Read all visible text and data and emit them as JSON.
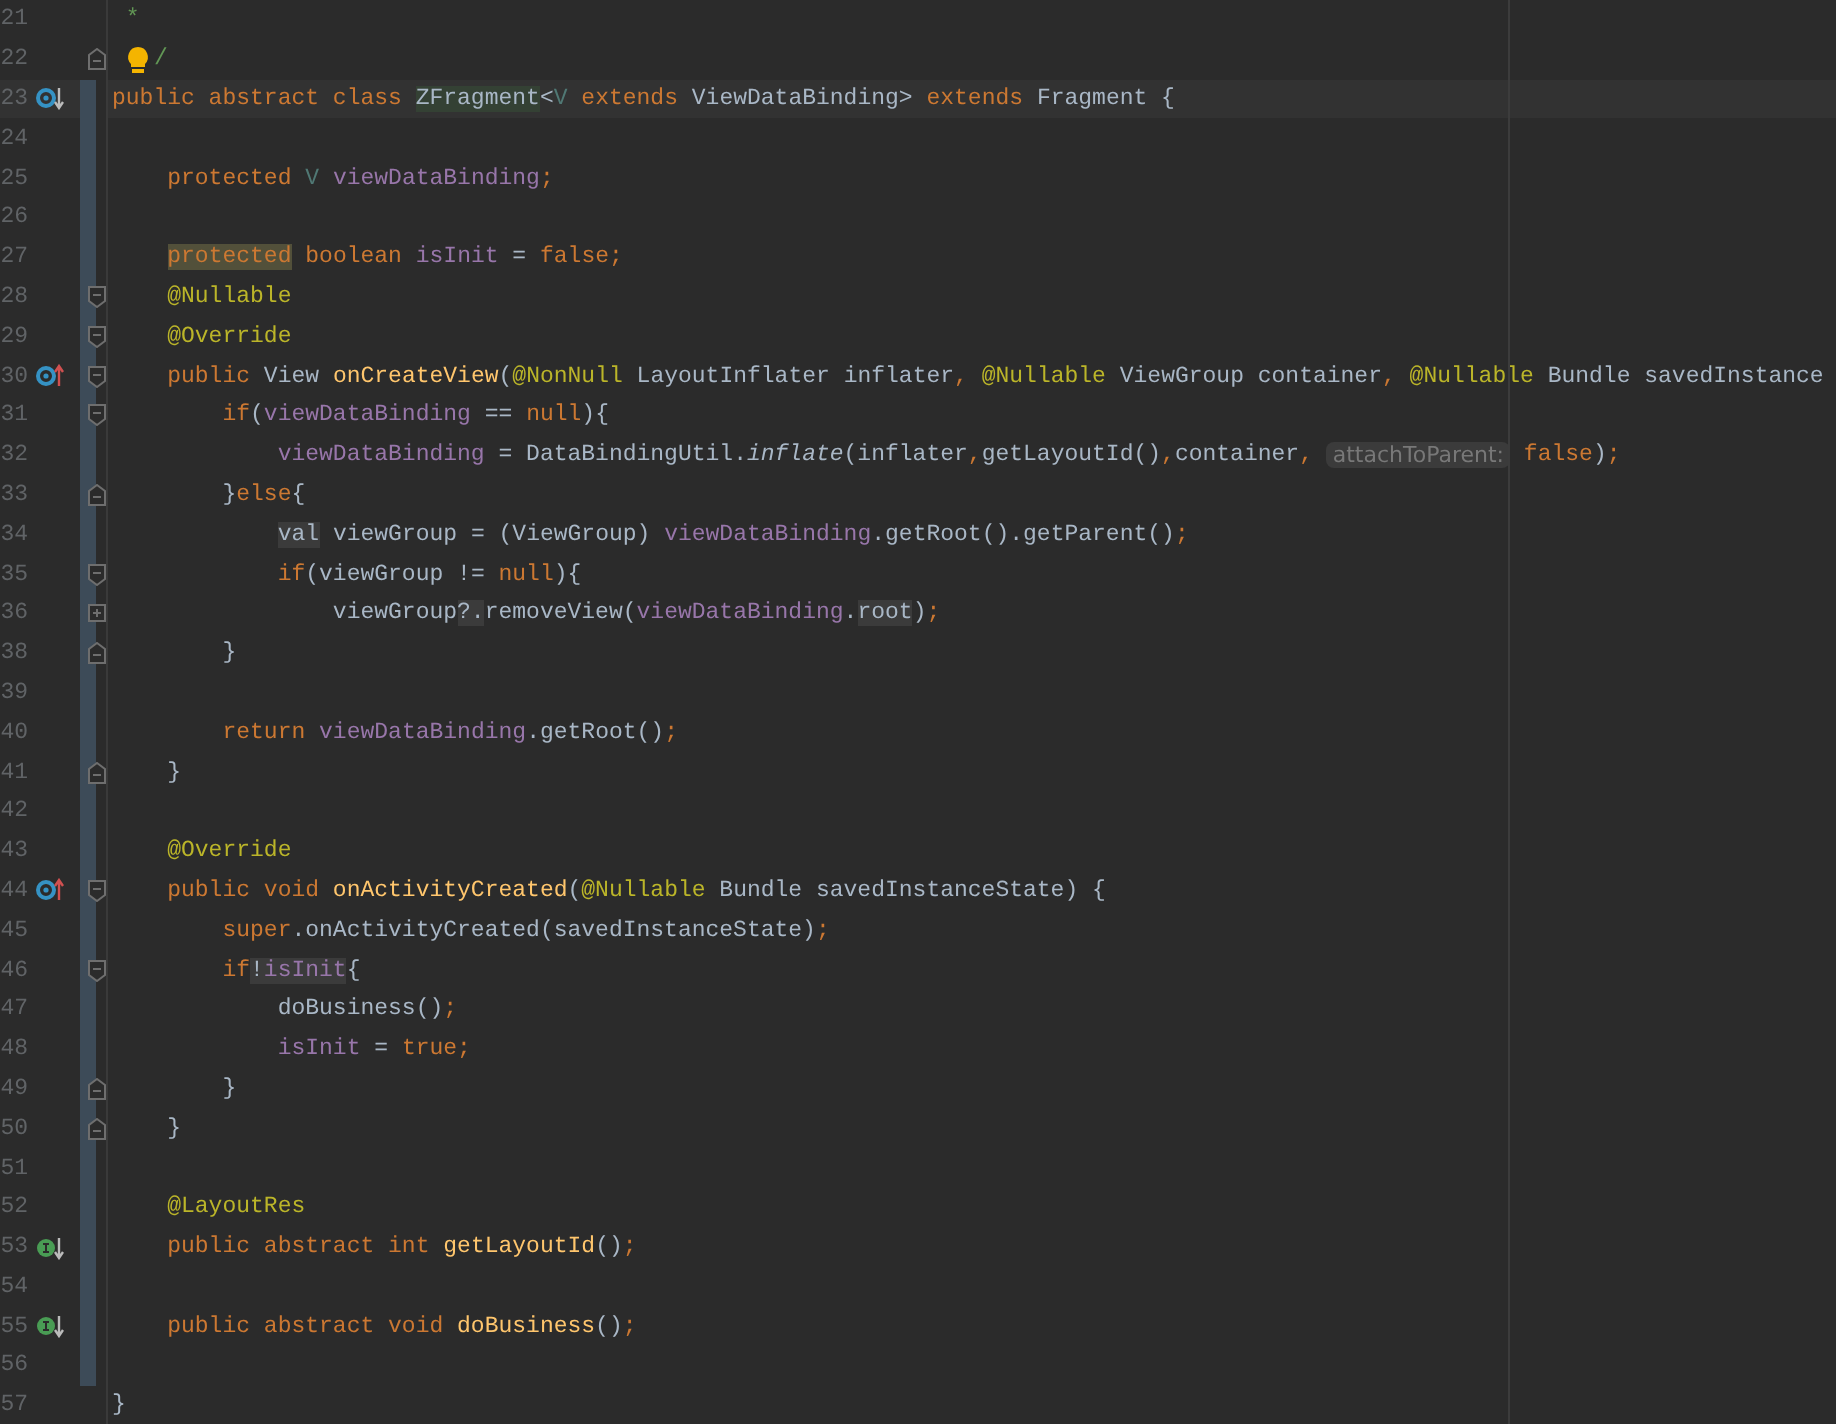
{
  "editor": {
    "lines": [
      {
        "number": "21",
        "modified": false,
        "tokens": [
          {
            "text": " *",
            "kind": "comment"
          }
        ]
      },
      {
        "number": "22",
        "modified": false,
        "fold": {
          "kind": "end"
        },
        "bulb": true,
        "tokens": [
          {
            "text": "/",
            "kind": "comment"
          }
        ]
      },
      {
        "number": "23",
        "modified": true,
        "current": true,
        "gutter_icon": {
          "kind": "implemented"
        },
        "tokens": [
          {
            "text": "public abstract class ",
            "kind": "keyword"
          },
          {
            "text": "ZFragment",
            "kind": "plain",
            "highlight": {
              "kind": "usage"
            }
          },
          {
            "text": "<",
            "kind": "plain"
          },
          {
            "text": "V",
            "kind": "type_param"
          },
          {
            "text": " extends ",
            "kind": "keyword"
          },
          {
            "text": "ViewDataBinding> ",
            "kind": "plain"
          },
          {
            "text": "extends ",
            "kind": "keyword"
          },
          {
            "text": "Fragment {",
            "kind": "plain"
          }
        ]
      },
      {
        "number": "24",
        "modified": true
      },
      {
        "number": "25",
        "modified": true,
        "tokens": [
          {
            "text": "    protected ",
            "kind": "keyword"
          },
          {
            "text": "V ",
            "kind": "type_param"
          },
          {
            "text": "viewDataBinding",
            "kind": "field"
          },
          {
            "text": ";",
            "kind": "keyword"
          }
        ]
      },
      {
        "number": "26",
        "modified": true
      },
      {
        "number": "27",
        "modified": true,
        "tokens": [
          {
            "text": "    protected",
            "kind": "keyword",
            "highlight": {
              "kind": "warning"
            }
          },
          {
            "text": " boolean ",
            "kind": "keyword"
          },
          {
            "text": "isInit",
            "kind": "field"
          },
          {
            "text": " = ",
            "kind": "plain"
          },
          {
            "text": "false;",
            "kind": "keyword"
          }
        ]
      },
      {
        "number": "28",
        "modified": true,
        "fold": {
          "kind": "start"
        },
        "tokens": [
          {
            "text": "    @Nullable",
            "kind": "annotation"
          }
        ]
      },
      {
        "number": "29",
        "modified": true,
        "fold": {
          "kind": "start"
        },
        "tokens": [
          {
            "text": "    @Override",
            "kind": "annotation"
          }
        ]
      },
      {
        "number": "30",
        "modified": true,
        "fold": {
          "kind": "start"
        },
        "gutter_icon": {
          "kind": "overrides"
        },
        "tokens": [
          {
            "text": "    public ",
            "kind": "keyword"
          },
          {
            "text": "View ",
            "kind": "plain"
          },
          {
            "text": "onCreateView",
            "kind": "method"
          },
          {
            "text": "(",
            "kind": "plain"
          },
          {
            "text": "@NonNull ",
            "kind": "annotation"
          },
          {
            "text": "LayoutInflater inflater",
            "kind": "plain"
          },
          {
            "text": ", ",
            "kind": "keyword"
          },
          {
            "text": "@Nullable ",
            "kind": "annotation"
          },
          {
            "text": "ViewGroup container",
            "kind": "plain"
          },
          {
            "text": ", ",
            "kind": "keyword"
          },
          {
            "text": "@Nullable ",
            "kind": "annotation"
          },
          {
            "text": "Bundle savedInstance",
            "kind": "plain"
          }
        ]
      },
      {
        "number": "31",
        "modified": true,
        "fold": {
          "kind": "start"
        },
        "tokens": [
          {
            "text": "        if",
            "kind": "keyword"
          },
          {
            "text": "(",
            "kind": "plain"
          },
          {
            "text": "viewDataBinding",
            "kind": "field"
          },
          {
            "text": " == ",
            "kind": "plain"
          },
          {
            "text": "null",
            "kind": "keyword"
          },
          {
            "text": "){",
            "kind": "plain"
          }
        ]
      },
      {
        "number": "32",
        "modified": true,
        "tokens": [
          {
            "text": "            viewDataBinding",
            "kind": "field"
          },
          {
            "text": " = DataBindingUtil.",
            "kind": "plain"
          },
          {
            "text": "inflate",
            "kind": "static_call"
          },
          {
            "text": "(inflater",
            "kind": "plain"
          },
          {
            "text": ",",
            "kind": "keyword"
          },
          {
            "text": "getLayoutId()",
            "kind": "plain"
          },
          {
            "text": ",",
            "kind": "keyword"
          },
          {
            "text": "container",
            "kind": "plain"
          },
          {
            "text": ", ",
            "kind": "keyword"
          },
          {
            "text": "attachToParent:",
            "kind": "hint"
          },
          {
            "text": " false",
            "kind": "keyword"
          },
          {
            "text": ")",
            "kind": "plain"
          },
          {
            "text": ";",
            "kind": "keyword"
          }
        ]
      },
      {
        "number": "33",
        "modified": true,
        "fold": {
          "kind": "end"
        },
        "tokens": [
          {
            "text": "        }",
            "kind": "plain"
          },
          {
            "text": "else",
            "kind": "keyword"
          },
          {
            "text": "{",
            "kind": "plain"
          }
        ]
      },
      {
        "number": "34",
        "modified": true,
        "tokens": [
          {
            "text": "            val",
            "kind": "plain",
            "highlight": {
              "kind": "subtle"
            }
          },
          {
            "text": " viewGroup = (ViewGroup) ",
            "kind": "plain"
          },
          {
            "text": "viewDataBinding",
            "kind": "field"
          },
          {
            "text": ".getRoot().getParent()",
            "kind": "plain"
          },
          {
            "text": ";",
            "kind": "keyword"
          }
        ]
      },
      {
        "number": "35",
        "modified": true,
        "fold": {
          "kind": "start"
        },
        "tokens": [
          {
            "text": "            if",
            "kind": "keyword"
          },
          {
            "text": "(viewGroup != ",
            "kind": "plain"
          },
          {
            "text": "null",
            "kind": "keyword"
          },
          {
            "text": "){",
            "kind": "plain"
          }
        ]
      },
      {
        "number": "36",
        "modified": true,
        "fold": {
          "kind": "collapsed"
        },
        "tokens": [
          {
            "text": "                viewGroup",
            "kind": "plain"
          },
          {
            "text": "?.",
            "kind": "plain",
            "highlight": {
              "kind": "subtle"
            }
          },
          {
            "text": "removeView(",
            "kind": "plain"
          },
          {
            "text": "viewDataBinding",
            "kind": "field"
          },
          {
            "text": ".",
            "kind": "plain"
          },
          {
            "text": "root",
            "kind": "plain",
            "highlight": {
              "kind": "subtle"
            }
          },
          {
            "text": ")",
            "kind": "plain"
          },
          {
            "text": ";",
            "kind": "keyword"
          }
        ]
      },
      {
        "number": "38",
        "modified": true,
        "fold": {
          "kind": "end"
        },
        "tokens": [
          {
            "text": "        }",
            "kind": "plain"
          }
        ]
      },
      {
        "number": "39",
        "modified": true
      },
      {
        "number": "40",
        "modified": true,
        "tokens": [
          {
            "text": "        return ",
            "kind": "keyword"
          },
          {
            "text": "viewDataBinding",
            "kind": "field"
          },
          {
            "text": ".getRoot()",
            "kind": "plain"
          },
          {
            "text": ";",
            "kind": "keyword"
          }
        ]
      },
      {
        "number": "41",
        "modified": true,
        "fold": {
          "kind": "end"
        },
        "tokens": [
          {
            "text": "    }",
            "kind": "plain"
          }
        ]
      },
      {
        "number": "42",
        "modified": true
      },
      {
        "number": "43",
        "modified": true,
        "tokens": [
          {
            "text": "    @Override",
            "kind": "annotation"
          }
        ]
      },
      {
        "number": "44",
        "modified": true,
        "fold": {
          "kind": "start"
        },
        "gutter_icon": {
          "kind": "overrides"
        },
        "tokens": [
          {
            "text": "    public void ",
            "kind": "keyword"
          },
          {
            "text": "onActivityCreated",
            "kind": "method"
          },
          {
            "text": "(",
            "kind": "plain"
          },
          {
            "text": "@Nullable ",
            "kind": "annotation"
          },
          {
            "text": "Bundle savedInstanceState) {",
            "kind": "plain"
          }
        ]
      },
      {
        "number": "45",
        "modified": true,
        "tokens": [
          {
            "text": "        super",
            "kind": "keyword"
          },
          {
            "text": ".onActivityCreated(savedInstanceState)",
            "kind": "plain"
          },
          {
            "text": ";",
            "kind": "keyword"
          }
        ]
      },
      {
        "number": "46",
        "modified": true,
        "fold": {
          "kind": "start"
        },
        "tokens": [
          {
            "text": "        if",
            "kind": "keyword"
          },
          {
            "text": "!",
            "kind": "plain",
            "highlight": {
              "kind": "subtle"
            }
          },
          {
            "text": "isInit",
            "kind": "field",
            "highlight": {
              "kind": "subtle"
            }
          },
          {
            "text": "{",
            "kind": "plain"
          }
        ]
      },
      {
        "number": "47",
        "modified": true,
        "tokens": [
          {
            "text": "            doBusiness()",
            "kind": "plain"
          },
          {
            "text": ";",
            "kind": "keyword"
          }
        ]
      },
      {
        "number": "48",
        "modified": true,
        "tokens": [
          {
            "text": "            isInit",
            "kind": "field"
          },
          {
            "text": " = ",
            "kind": "plain"
          },
          {
            "text": "true;",
            "kind": "keyword"
          }
        ]
      },
      {
        "number": "49",
        "modified": true,
        "fold": {
          "kind": "end"
        },
        "tokens": [
          {
            "text": "        }",
            "kind": "plain"
          }
        ]
      },
      {
        "number": "50",
        "modified": true,
        "fold": {
          "kind": "end"
        },
        "tokens": [
          {
            "text": "    }",
            "kind": "plain"
          }
        ]
      },
      {
        "number": "51",
        "modified": true
      },
      {
        "number": "52",
        "modified": true,
        "tokens": [
          {
            "text": "    @LayoutRes",
            "kind": "annotation"
          }
        ]
      },
      {
        "number": "53",
        "modified": true,
        "gutter_icon": {
          "kind": "implemented_abstract"
        },
        "tokens": [
          {
            "text": "    public abstract int ",
            "kind": "keyword"
          },
          {
            "text": "getLayoutId",
            "kind": "method"
          },
          {
            "text": "()",
            "kind": "plain"
          },
          {
            "text": ";",
            "kind": "keyword"
          }
        ]
      },
      {
        "number": "54",
        "modified": true
      },
      {
        "number": "55",
        "modified": true,
        "gutter_icon": {
          "kind": "implemented_abstract"
        },
        "tokens": [
          {
            "text": "    public abstract void ",
            "kind": "keyword"
          },
          {
            "text": "doBusiness",
            "kind": "method"
          },
          {
            "text": "()",
            "kind": "plain"
          },
          {
            "text": ";",
            "kind": "keyword"
          }
        ]
      },
      {
        "number": "56",
        "modified": true
      },
      {
        "number": "57",
        "modified": false,
        "tokens": [
          {
            "text": "}",
            "kind": "plain"
          }
        ]
      }
    ]
  }
}
